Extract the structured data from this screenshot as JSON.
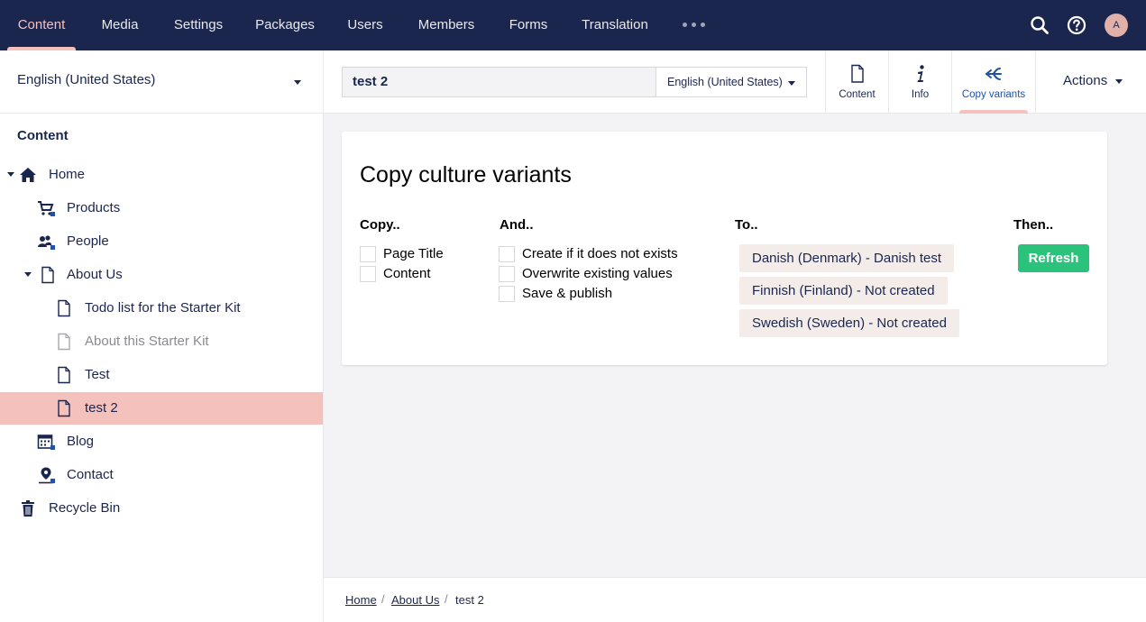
{
  "topnav": {
    "items": [
      "Content",
      "Media",
      "Settings",
      "Packages",
      "Users",
      "Members",
      "Forms",
      "Translation"
    ],
    "active": "Content",
    "avatar_initial": "A"
  },
  "sidebar": {
    "language": "English (United States)",
    "tree_title": "Content",
    "tree": [
      {
        "label": "Home",
        "icon": "home-icon",
        "expanded": true
      },
      {
        "label": "Products",
        "icon": "shopping-cart-icon"
      },
      {
        "label": "People",
        "icon": "people-icon"
      },
      {
        "label": "About Us",
        "icon": "document-icon",
        "expanded": true
      },
      {
        "label": "Todo list for the Starter Kit",
        "icon": "document-icon"
      },
      {
        "label": "About this Starter Kit",
        "icon": "document-icon",
        "unpublished": true
      },
      {
        "label": "Test",
        "icon": "document-icon"
      },
      {
        "label": "test 2",
        "icon": "document-icon",
        "selected": true
      },
      {
        "label": "Blog",
        "icon": "calendar-icon"
      },
      {
        "label": "Contact",
        "icon": "map-pin-icon"
      },
      {
        "label": "Recycle Bin",
        "icon": "trash-icon"
      }
    ]
  },
  "header": {
    "node_name": "test 2",
    "language": "English (United States)",
    "tabs": [
      {
        "label": "Content",
        "icon": "document-icon"
      },
      {
        "label": "Info",
        "icon": "info-icon"
      },
      {
        "label": "Copy variants",
        "icon": "branch-arrow-icon",
        "active": true
      }
    ],
    "actions_label": "Actions"
  },
  "panel": {
    "title": "Copy culture variants",
    "copy": {
      "heading": "Copy..",
      "options": [
        "Page Title",
        "Content"
      ]
    },
    "and": {
      "heading": "And..",
      "options": [
        "Create if it does not exists",
        "Overwrite existing values",
        "Save & publish"
      ]
    },
    "to": {
      "heading": "To..",
      "cultures": [
        "Danish (Denmark) - Danish test",
        "Finnish (Finland) - Not created",
        "Swedish (Sweden) - Not created"
      ]
    },
    "then": {
      "heading": "Then..",
      "button": "Refresh"
    }
  },
  "breadcrumb": [
    "Home",
    "About Us",
    "test 2"
  ],
  "colors": {
    "navy": "#1b264f",
    "accent_pink": "#f5c1bc",
    "button_green": "#2bc37c",
    "active_blue": "#2152a3"
  }
}
